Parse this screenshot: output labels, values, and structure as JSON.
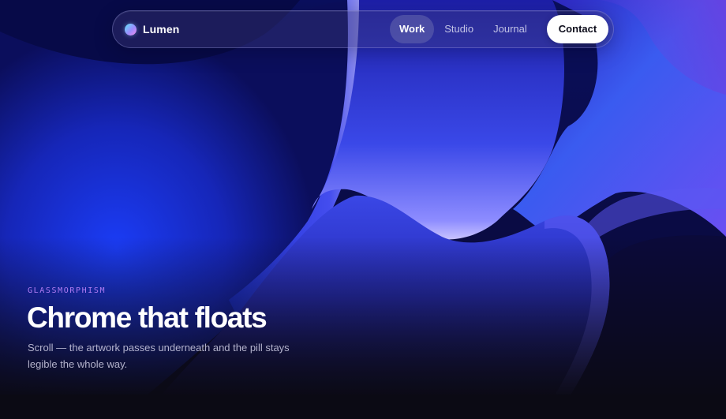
{
  "nav": {
    "brand_name": "Lumen",
    "links": [
      {
        "label": "Work",
        "active": true
      },
      {
        "label": "Studio",
        "active": false
      },
      {
        "label": "Journal",
        "active": false
      }
    ],
    "cta_label": "Contact"
  },
  "hero": {
    "eyebrow": "GLASSMORPHISM",
    "title": "Chrome that floats",
    "subtitle": "Scroll — the artwork passes underneath and the pill stays legible the whole way."
  },
  "colors": {
    "page_background": "#0b0a14",
    "accent_eyebrow": "#b07cf2",
    "cta_background": "#ffffff",
    "brand_dot_gradient": [
      "#5fe4f7",
      "#9b8cff",
      "#f08be8"
    ]
  },
  "icons": {
    "brand_mark": "gradient-dot"
  }
}
